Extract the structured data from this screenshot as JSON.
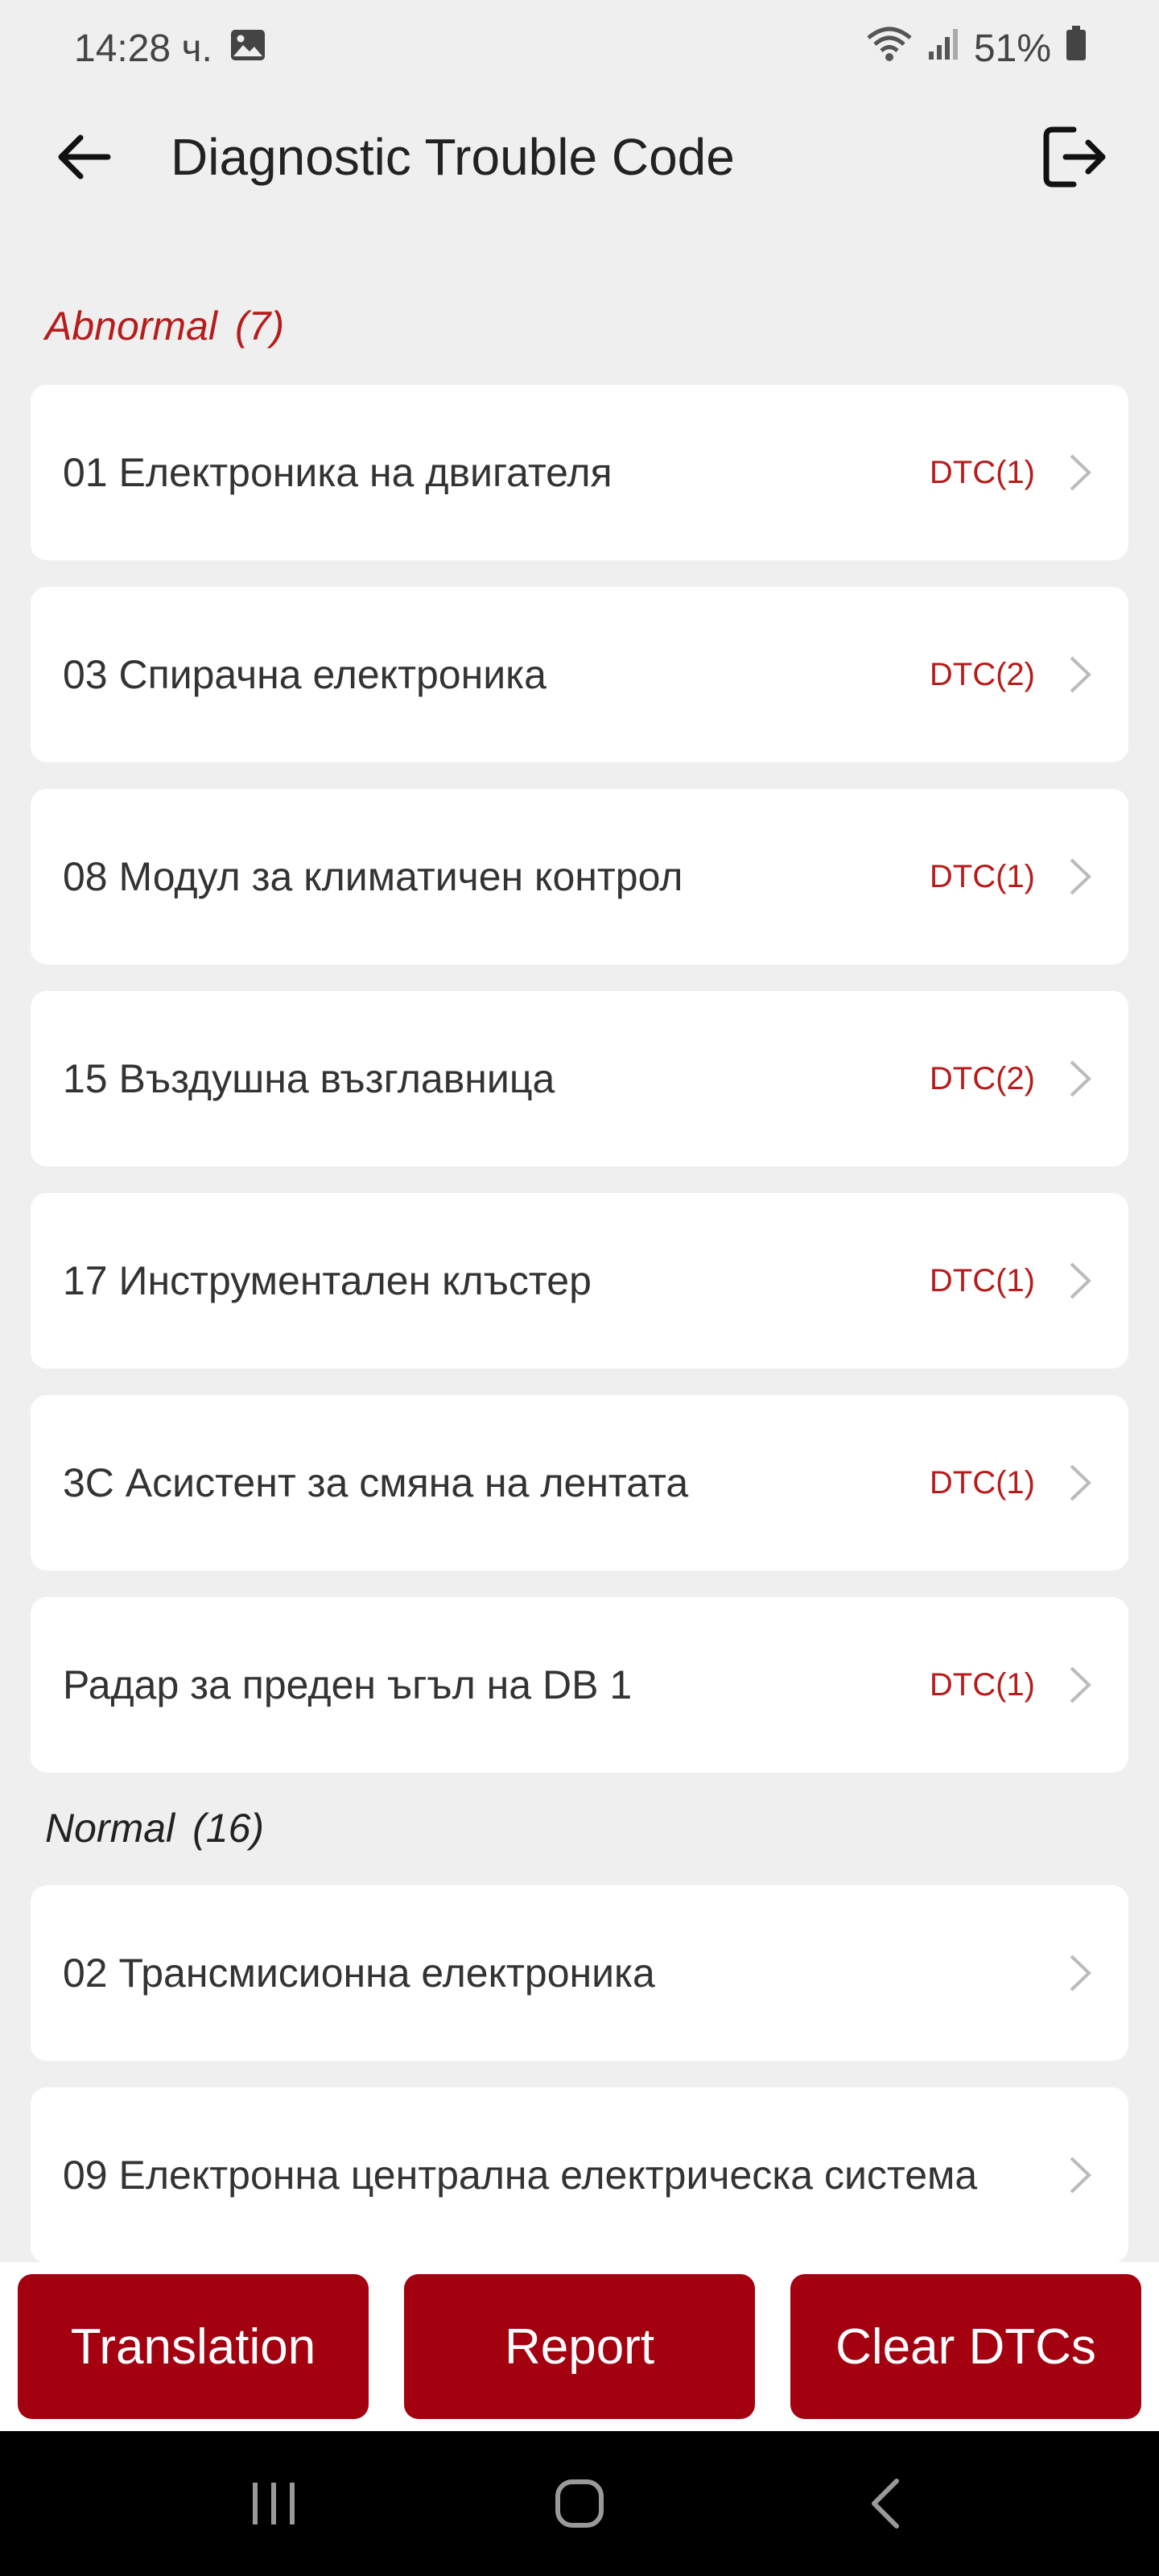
{
  "status_bar": {
    "time": "14:28 ч.",
    "battery": "51%",
    "icons": [
      "image-icon",
      "wifi-icon",
      "signal-icon",
      "battery-icon"
    ]
  },
  "app_bar": {
    "title": "Diagnostic Trouble Code",
    "back_icon": "arrow-left-icon",
    "exit_icon": "logout-icon"
  },
  "abnormal": {
    "label": "Abnormal",
    "count": "(7)",
    "items": [
      {
        "label": "01 Електроника на двигателя",
        "dtc": "DTC(1)"
      },
      {
        "label": "03 Спирачна електроника",
        "dtc": "DTC(2)"
      },
      {
        "label": "08 Модул за климатичен контрол",
        "dtc": "DTC(1)"
      },
      {
        "label": "15 Въздушна възглавница",
        "dtc": "DTC(2)"
      },
      {
        "label": "17 Инструментален клъстер",
        "dtc": "DTC(1)"
      },
      {
        "label": "3C Асистент за смяна на лентата",
        "dtc": "DTC(1)"
      },
      {
        "label": "Радар за преден ъгъл на DB 1",
        "dtc": "DTC(1)"
      }
    ]
  },
  "normal": {
    "label": "Normal",
    "count": "(16)",
    "items": [
      {
        "label": "02 Трансмисионна електроника"
      },
      {
        "label": "09 Електронна централна електрическа система"
      }
    ]
  },
  "actions": {
    "translation": "Translation",
    "report": "Report",
    "clear": "Clear DTCs"
  },
  "colors": {
    "accent": "#a30010",
    "abnormal_text": "#b71c1c",
    "background": "#efefef"
  }
}
